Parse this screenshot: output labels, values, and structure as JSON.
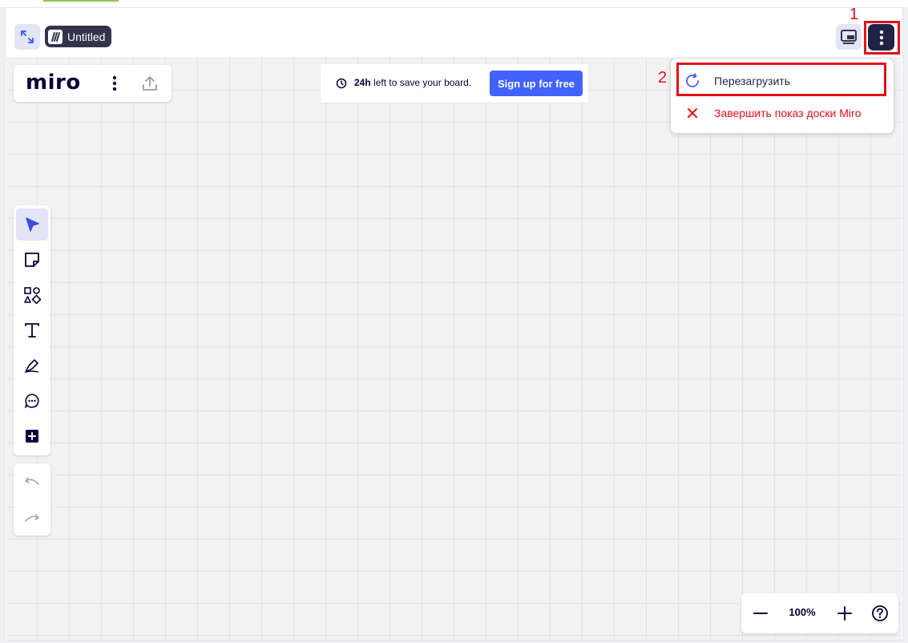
{
  "embed": {
    "board_title": "Untitled",
    "icons": {
      "expand": "expand-arrows-icon",
      "miro_logo": "miro-logo-icon",
      "panel": "present-panel-icon",
      "more": "vertical-dots-icon"
    }
  },
  "annotations": {
    "step1": "1",
    "step2": "2",
    "highlight_color": "#e3101a"
  },
  "brand": {
    "name": "miro",
    "icons": [
      "vertical-dots-icon",
      "upload-icon"
    ]
  },
  "save_banner": {
    "bold": "24h",
    "text": " left to save your board.",
    "button": "Sign up for free",
    "button_color": "#4262ff"
  },
  "menu": {
    "items": [
      {
        "label": "Перезагрузить",
        "icon": "reload-icon"
      },
      {
        "label": "Завершить показ доски Miro",
        "icon": "close-x-icon"
      }
    ]
  },
  "toolbar": {
    "tools": [
      "select-arrow-icon",
      "sticky-note-icon",
      "shapes-icon",
      "text-icon",
      "pen-icon",
      "comment-icon",
      "add-more-icon"
    ],
    "active": "select-arrow-icon",
    "history": [
      "undo-icon",
      "redo-icon"
    ]
  },
  "zoom": {
    "value": "100%",
    "icons": [
      "zoom-out-icon",
      "zoom-in-icon",
      "help-icon"
    ]
  }
}
